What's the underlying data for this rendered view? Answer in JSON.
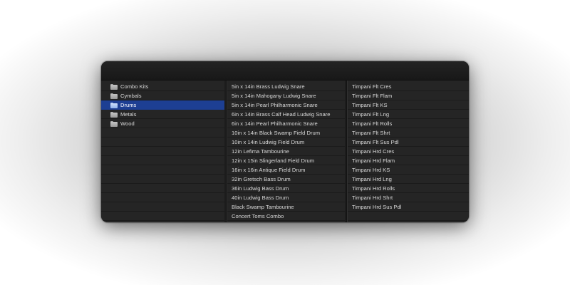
{
  "categories": [
    {
      "label": "Combo Kits",
      "icon": "folder-icon",
      "selected": false
    },
    {
      "label": "Cymbals",
      "icon": "folder-icon",
      "selected": false
    },
    {
      "label": "Drums",
      "icon": "folder-icon",
      "selected": true
    },
    {
      "label": "Metals",
      "icon": "folder-icon",
      "selected": false
    },
    {
      "label": "Wood",
      "icon": "folder-icon",
      "selected": false
    }
  ],
  "drums": [
    "5in x 14in Brass Ludwig Snare",
    "5in x 14in Mahogany Ludwig Snare",
    "5in x 14in Pearl Philharmonic Snare",
    "6in x 14in Brass Calf Head Ludwig Snare",
    "6in x 14in Pearl Philharmonic Snare",
    "10in x 14in Black Swamp Field Drum",
    "10in x 14in Ludwig Field Drum",
    "12in Lefima Tambourine",
    "12in x 15in Slingerland Field Drum",
    "16in x 16in Antique Field Drum",
    "32in Gretsch Bass Drum",
    "36in Ludwig Bass Drum",
    "40in Ludwig Bass Drum",
    "Black Swamp Tambourine",
    "Concert Toms Combo"
  ],
  "articulations": [
    "Timpani Flt Cres",
    "Timpani Flt Flam",
    "Timpani Flt KS",
    "Timpani Flt Lng",
    "Timpani Flt Rolls",
    "Timpani Flt Shrt",
    "Timpani Flt Sus Pdl",
    "Timpani Hrd Cres",
    "Timpani Hrd Flam",
    "Timpani Hrd KS",
    "Timpani Hrd Lng",
    "Timpani Hrd Rolls",
    "Timpani Hrd Shrt",
    "Timpani Hrd Sus Pdl"
  ],
  "colors": {
    "selection": "#1d3f93",
    "window_bg": "#262626",
    "text": "#d8d8d8"
  }
}
